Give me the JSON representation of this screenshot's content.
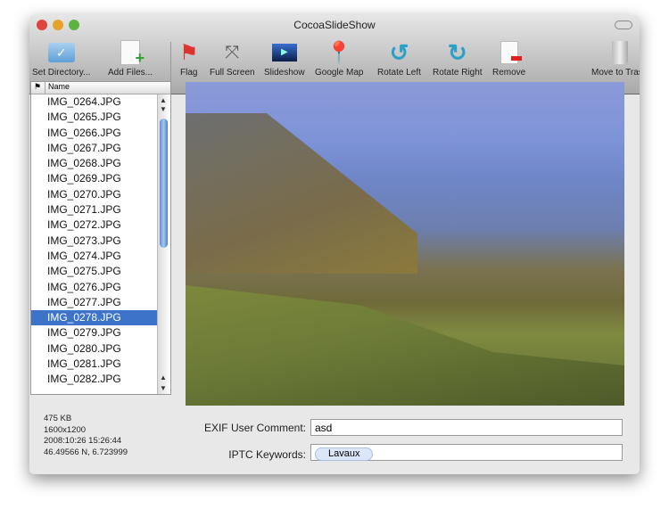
{
  "window": {
    "title": "CocoaSlideShow"
  },
  "toolbar": [
    {
      "label": "Set Directory...",
      "icon": "folder-icon"
    },
    {
      "label": "Add Files...",
      "icon": "add-file-icon"
    },
    {
      "label": "Flag",
      "icon": "flag-icon"
    },
    {
      "label": "Full Screen",
      "icon": "fullscreen-icon"
    },
    {
      "label": "Slideshow",
      "icon": "slideshow-icon"
    },
    {
      "label": "Google Map",
      "icon": "map-pin-icon"
    },
    {
      "label": "Rotate Left",
      "icon": "rotate-left-icon"
    },
    {
      "label": "Rotate Right",
      "icon": "rotate-right-icon"
    },
    {
      "label": "Remove",
      "icon": "remove-file-icon"
    },
    {
      "label": "Move to Trash",
      "icon": "trash-icon"
    }
  ],
  "list": {
    "flag_header": "⚑",
    "name_header": "Name",
    "selected": "IMG_0278.JPG",
    "items": [
      "IMG_0264.JPG",
      "IMG_0265.JPG",
      "IMG_0266.JPG",
      "IMG_0267.JPG",
      "IMG_0268.JPG",
      "IMG_0269.JPG",
      "IMG_0270.JPG",
      "IMG_0271.JPG",
      "IMG_0272.JPG",
      "IMG_0273.JPG",
      "IMG_0274.JPG",
      "IMG_0275.JPG",
      "IMG_0276.JPG",
      "IMG_0277.JPG",
      "IMG_0278.JPG",
      "IMG_0279.JPG",
      "IMG_0280.JPG",
      "IMG_0281.JPG",
      "IMG_0282.JPG"
    ]
  },
  "info": {
    "size": "475 KB",
    "dimensions": "1600x1200",
    "date": "2008:10:26 15:26:44",
    "coords": "46.49566 N, 6.723999"
  },
  "exif": {
    "label": "EXIF User Comment:",
    "value": "asd"
  },
  "iptc": {
    "label": "IPTC Keywords:",
    "keywords": [
      "Lavaux"
    ]
  }
}
